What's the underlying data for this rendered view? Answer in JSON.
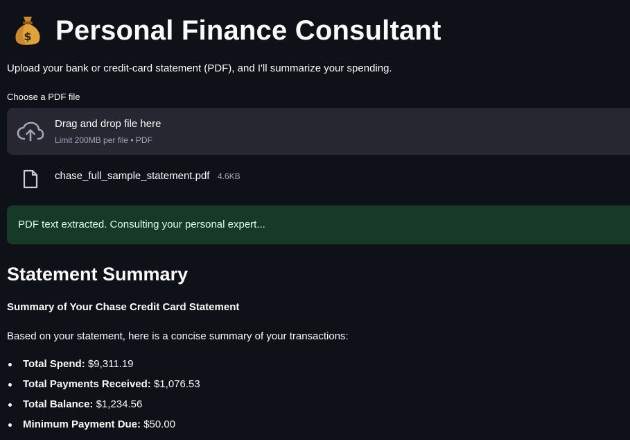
{
  "app": {
    "title": "Personal Finance Consultant",
    "title_icon": "money-bag-icon",
    "intro": "Upload your bank or credit-card statement (PDF), and I'll summarize your spending."
  },
  "uploader": {
    "label": "Choose a PDF file",
    "drop_title": "Drag and drop file here",
    "limit_text": "Limit 200MB per file • PDF",
    "upload_icon": "cloud-upload-icon",
    "file": {
      "name": "chase_full_sample_statement.pdf",
      "size": "4.6KB",
      "icon": "file-icon"
    }
  },
  "status": {
    "message": "PDF text extracted. Consulting your personal expert...",
    "color": "#173928"
  },
  "summary": {
    "heading": "Statement Summary",
    "subtitle": "Summary of Your Chase Credit Card Statement",
    "intro": "Based on your statement, here is a concise summary of your transactions:",
    "items": [
      {
        "label": "Total Spend:",
        "value": "$9,311.19"
      },
      {
        "label": "Total Payments Received:",
        "value": "$1,076.53"
      },
      {
        "label": "Total Balance:",
        "value": "$1,234.56"
      },
      {
        "label": "Minimum Payment Due:",
        "value": "$50.00"
      }
    ]
  },
  "colors": {
    "background": "#0e1117",
    "dropzone": "#262730",
    "success_bg": "#173928",
    "text": "#fafafa",
    "muted": "#a3a8b8"
  }
}
